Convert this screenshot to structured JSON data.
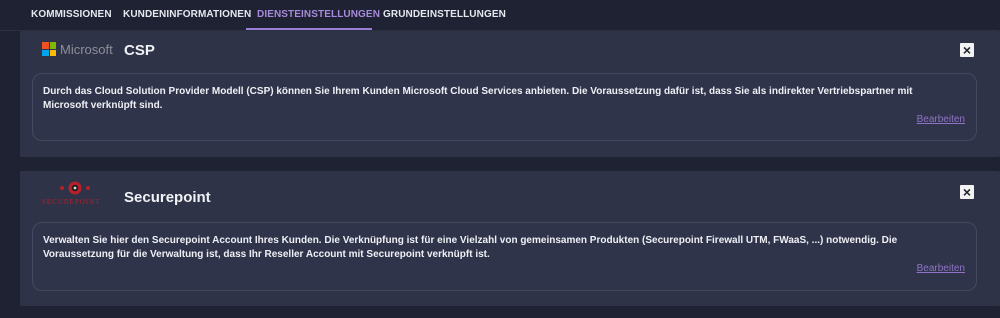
{
  "tabs": [
    {
      "label": "KOMMISSIONEN"
    },
    {
      "label": "KUNDENINFORMATIONEN"
    },
    {
      "label": "DIENSTEINSTELLUNGEN",
      "active": true
    },
    {
      "label": "GRUNDEINSTELLUNGEN"
    }
  ],
  "colors": {
    "background": "#1f2233",
    "card": "#2f3347",
    "accent": "#a78bda",
    "link": "#8f73c7",
    "ms_red": "#f25022",
    "ms_green": "#7fba00",
    "ms_blue": "#00a4ef",
    "ms_yellow": "#ffb900",
    "securepoint_red": "#b5202a"
  },
  "cards": [
    {
      "logo": {
        "icon": "microsoft-logo",
        "wordmark": "Microsoft"
      },
      "title": "CSP",
      "description": "Durch das Cloud Solution Provider Modell (CSP) können Sie Ihrem Kunden Microsoft Cloud Services anbieten. Die Voraussetzung dafür ist, dass Sie als indirekter Vertriebspartner mit Microsoft verknüpft sind.",
      "edit_label": "Bearbeiten",
      "close_icon": "close-icon"
    },
    {
      "logo": {
        "icon": "securepoint-logo",
        "wordmark": "SECUREPOINT"
      },
      "title": "Securepoint",
      "description": "Verwalten Sie hier den Securepoint Account Ihres Kunden. Die Verknüpfung ist für eine Vielzahl von gemeinsamen Produkten (Securepoint Firewall UTM, FWaaS, ...) notwendig. Die Voraussetzung für die Verwaltung ist, dass Ihr Reseller Account mit Securepoint verknüpft ist.",
      "edit_label": "Bearbeiten",
      "close_icon": "close-icon"
    }
  ]
}
